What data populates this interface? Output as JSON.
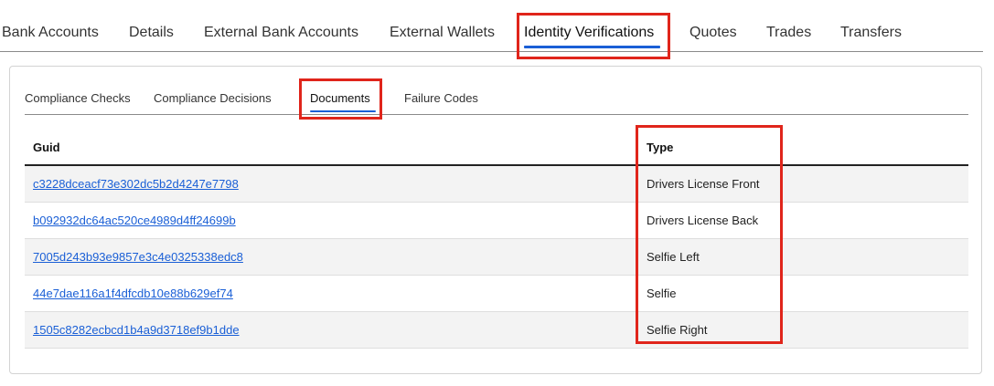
{
  "top_tabs": [
    {
      "label": "Bank Accounts"
    },
    {
      "label": "Details"
    },
    {
      "label": "External Bank Accounts"
    },
    {
      "label": "External Wallets"
    },
    {
      "label": "Identity Verifications"
    },
    {
      "label": "Quotes"
    },
    {
      "label": "Trades"
    },
    {
      "label": "Transfers"
    }
  ],
  "active_top_tab": "Identity Verifications",
  "sub_tabs": [
    {
      "label": "Compliance Checks"
    },
    {
      "label": "Compliance Decisions"
    },
    {
      "label": "Documents"
    },
    {
      "label": "Failure Codes"
    }
  ],
  "active_sub_tab": "Documents",
  "table": {
    "headers": {
      "guid": "Guid",
      "type": "Type"
    },
    "rows": [
      {
        "guid": "c3228dceacf73e302dc5b2d4247e7798",
        "type": "Drivers License Front"
      },
      {
        "guid": "b092932dc64ac520ce4989d4ff24699b",
        "type": "Drivers License Back"
      },
      {
        "guid": "7005d243b93e9857e3c4e0325338edc8",
        "type": "Selfie Left"
      },
      {
        "guid": "44e7dae116a1f4dfcdb10e88b629ef74",
        "type": "Selfie"
      },
      {
        "guid": "1505c8282ecbcd1b4a9d3718ef9b1dde",
        "type": "Selfie Right"
      }
    ]
  },
  "colors": {
    "accent": "#1a5fd6",
    "highlight": "#e0251b",
    "row_stripe": "#f3f3f3"
  }
}
